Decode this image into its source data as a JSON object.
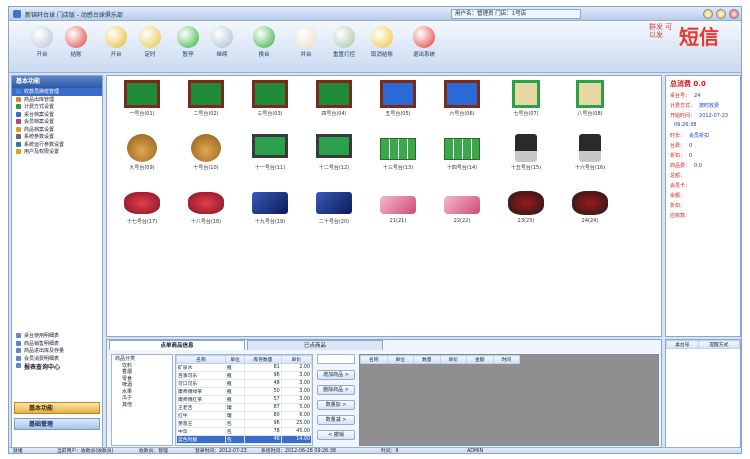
{
  "window": {
    "title": "新锦轩台球 门店版 - 动感台球俱乐部",
    "user_info": "用户名：管理员  门店：1号店"
  },
  "toolbar": [
    {
      "label": "开台",
      "icon": "camera-icon",
      "color": "#b9c2cf"
    },
    {
      "label": "结账",
      "icon": "record-icon",
      "color": "#e0403b"
    },
    {
      "label": "开台",
      "icon": "arrow-down-icon",
      "color": "#e8b72a"
    },
    {
      "label": "定时",
      "icon": "clock-icon",
      "color": "#e6c23a"
    },
    {
      "label": "暂停",
      "icon": "pause-icon",
      "color": "#33b33a"
    },
    {
      "label": "继续",
      "icon": "check-icon",
      "color": "#a9b9cf"
    },
    {
      "label": "换台",
      "icon": "refresh-icon",
      "color": "#2faa3a"
    },
    {
      "label": "并台",
      "icon": "document-icon",
      "color": "#e9dcc1"
    },
    {
      "label": "重置灯控",
      "icon": "light-control-icon",
      "color": "#a8c0a2"
    },
    {
      "label": "取消结账",
      "icon": "thumb-up-icon",
      "color": "#f0c431"
    },
    {
      "label": "退出系统",
      "icon": "exit-icon",
      "color": "#e23a2e"
    }
  ],
  "brand": {
    "slogan": "群发 可以发",
    "name": "短信"
  },
  "left_panel": {
    "header": "基本功能",
    "menu": [
      {
        "label": "收款员换班管理",
        "icon": "user-icon",
        "color": "#3a8ad6",
        "selected": true
      },
      {
        "label": "商品出库管理",
        "icon": "box-icon",
        "color": "#d08a2a"
      },
      {
        "label": "计费方式设置",
        "icon": "money-icon",
        "color": "#2e9a3a"
      },
      {
        "label": "桌台档案设置",
        "icon": "table-icon",
        "color": "#3a6ccb"
      },
      {
        "label": "会员档案设置",
        "icon": "member-icon",
        "color": "#c23a8a"
      },
      {
        "label": "商品档案设置",
        "icon": "goods-icon",
        "color": "#d0a22a"
      },
      {
        "label": "系统参数设置",
        "icon": "settings-icon",
        "color": "#6a6a6a"
      },
      {
        "label": "系统运行参数设置",
        "icon": "config-icon",
        "color": "#2a7ab8"
      },
      {
        "label": "用户及权限设置",
        "icon": "key-icon",
        "color": "#d6a21a"
      }
    ],
    "lower_menu": [
      {
        "label": "桌台使用明细表",
        "icon": "report-icon"
      },
      {
        "label": "商品销售明细表",
        "icon": "report-icon"
      },
      {
        "label": "商品进出库及存量",
        "icon": "report-icon"
      },
      {
        "label": "会员消费明细表",
        "icon": "report-icon"
      },
      {
        "label": "报表查询中心",
        "icon": "report-center-icon"
      }
    ],
    "buttons": [
      "基本功能",
      "基础管理"
    ]
  },
  "tables": [
    {
      "label": "一号台(01)",
      "kind": "pool"
    },
    {
      "label": "二号台(02)",
      "kind": "pool"
    },
    {
      "label": "三号台(03)",
      "kind": "pool"
    },
    {
      "label": "四号台(04)",
      "kind": "pool"
    },
    {
      "label": "五号台(05)",
      "kind": "pool-blue"
    },
    {
      "label": "六号台(06)",
      "kind": "pool-blue"
    },
    {
      "label": "七号台(07)",
      "kind": "mahjong"
    },
    {
      "label": "八号台(08)",
      "kind": "mahjong"
    },
    {
      "label": "九号台(09)",
      "kind": "teapot"
    },
    {
      "label": "十号台(10)",
      "kind": "teapot"
    },
    {
      "label": "十一号台(11)",
      "kind": "pool-active"
    },
    {
      "label": "十二号台(12)",
      "kind": "pool-active"
    },
    {
      "label": "十三号台(13)",
      "kind": "tennis"
    },
    {
      "label": "十四号台(14)",
      "kind": "tennis"
    },
    {
      "label": "十五号台(15)",
      "kind": "skate"
    },
    {
      "label": "十六号台(16)",
      "kind": "skate"
    },
    {
      "label": "十七号台(17)",
      "kind": "gamepad-red"
    },
    {
      "label": "十八号台(18)",
      "kind": "gamepad-red"
    },
    {
      "label": "十九号台(19)",
      "kind": "console"
    },
    {
      "label": "二十号台(20)",
      "kind": "console"
    },
    {
      "label": "21(21)",
      "kind": "phone"
    },
    {
      "label": "22(22)",
      "kind": "phone"
    },
    {
      "label": "23(23)",
      "kind": "xbox"
    },
    {
      "label": "24(24)",
      "kind": "xbox"
    }
  ],
  "info": {
    "title": "总消费 0.0",
    "fields": [
      {
        "label": "桌台号：",
        "value": "24"
      },
      {
        "label": "计费方式：",
        "value": "按时收费"
      },
      {
        "label": "开始时间：",
        "value": "2012-07-23"
      },
      {
        "label": "",
        "value": "09:26:38"
      },
      {
        "label": "时长：",
        "value": "会员折扣"
      },
      {
        "label": "台费：",
        "value": "0"
      },
      {
        "label": "折扣：",
        "value": "0"
      },
      {
        "label": "商品费：",
        "value": "0.0"
      },
      {
        "label": "总额：",
        "value": ""
      },
      {
        "label": "会员卡：",
        "value": ""
      },
      {
        "label": "余额：",
        "value": ""
      },
      {
        "label": "折扣：",
        "value": ""
      },
      {
        "label": "应收款：",
        "value": ""
      }
    ]
  },
  "bottom": {
    "tabs": [
      "点单商品信息",
      "已点商品"
    ],
    "tree": [
      "商品分类",
      "饮料",
      "香烟",
      "零食",
      "啤酒",
      "水果",
      "瓜子",
      "其他"
    ],
    "product_headers": [
      "名称",
      "单位",
      "库存数量",
      "单价"
    ],
    "products": [
      [
        "矿泉水",
        "瓶",
        "81",
        "2.00"
      ],
      [
        "百事可乐",
        "瓶",
        "96",
        "3.00"
      ],
      [
        "可口可乐",
        "瓶",
        "48",
        "3.00"
      ],
      [
        "康师傅绿茶",
        "瓶",
        "50",
        "3.00"
      ],
      [
        "康师傅红茶",
        "瓶",
        "57",
        "3.00"
      ],
      [
        "王老吉",
        "罐",
        "87",
        "5.00"
      ],
      [
        "红牛",
        "罐",
        "80",
        "6.00"
      ],
      [
        "芙蓉王",
        "包",
        "96",
        "25.00"
      ],
      [
        "中华",
        "包",
        "78",
        "45.00"
      ],
      [
        "蓝色利群",
        "包",
        "46",
        "14.00"
      ]
    ],
    "search_placeholder": "",
    "actions": [
      "增加商品 >",
      "删除商品 >",
      "数量加 >",
      "数量减 >",
      "< 撤销"
    ],
    "order_headers": [
      "名称",
      "单位",
      "数量",
      "单价",
      "金额",
      "时间"
    ],
    "right_headers": [
      "桌台号",
      "提醒方式"
    ]
  },
  "status": [
    {
      "text": "就绪"
    },
    {
      "text": "当前用户：收款员(收款员)"
    },
    {
      "text": "收款员：管理"
    },
    {
      "text": "登录时间：2012-07-23"
    },
    {
      "text": "系统时间：2012-06-28 09:26:38"
    },
    {
      "text": "时间：9"
    },
    {
      "text": "ADMIN"
    }
  ]
}
